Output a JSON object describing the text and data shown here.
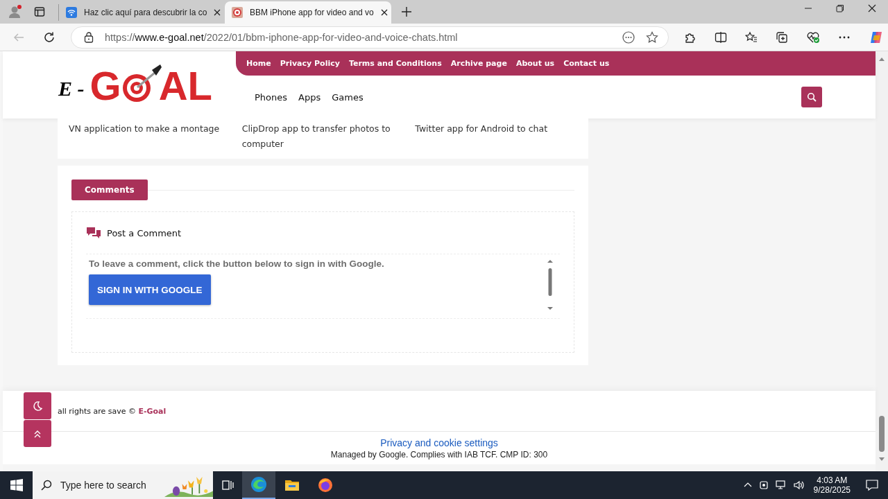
{
  "browser": {
    "tabs": [
      {
        "title": "Haz clic aquí para descubrir la co",
        "selected": false
      },
      {
        "title": "BBM iPhone app for video and vo",
        "selected": true
      }
    ],
    "url": {
      "scheme": "https://",
      "host": "www.e-goal.net",
      "path": "/2022/01/bbm-iphone-app-for-video-and-voice-chats.html"
    }
  },
  "site": {
    "logo": {
      "prefix": "E -",
      "before_target": "G",
      "after_target": "AL"
    },
    "top_menu": [
      "Home",
      "Privacy Policy",
      "Terms and Conditions",
      "Archive page",
      "About us",
      "Contact us"
    ],
    "main_menu": [
      "Phones",
      "Apps",
      "Games"
    ]
  },
  "related_posts": [
    "VN application to make a montage",
    "ClipDrop app to transfer photos to computer",
    "Twitter app for Android to chat"
  ],
  "comments": {
    "heading": "Comments",
    "post_title": "Post a Comment",
    "notice": "To leave a comment, click the button below to sign in with Google.",
    "sign_in_button": "SIGN IN WITH GOOGLE"
  },
  "footer": {
    "text": "all rights are save ©",
    "brand": "E-Goal"
  },
  "cookie_bar": {
    "link": "Privacy and cookie settings",
    "note": "Managed by Google. Complies with IAB TCF. CMP ID: 300"
  },
  "taskbar": {
    "search_placeholder": "Type here to search",
    "time": "4:03 AM",
    "date": "9/28/2025"
  }
}
